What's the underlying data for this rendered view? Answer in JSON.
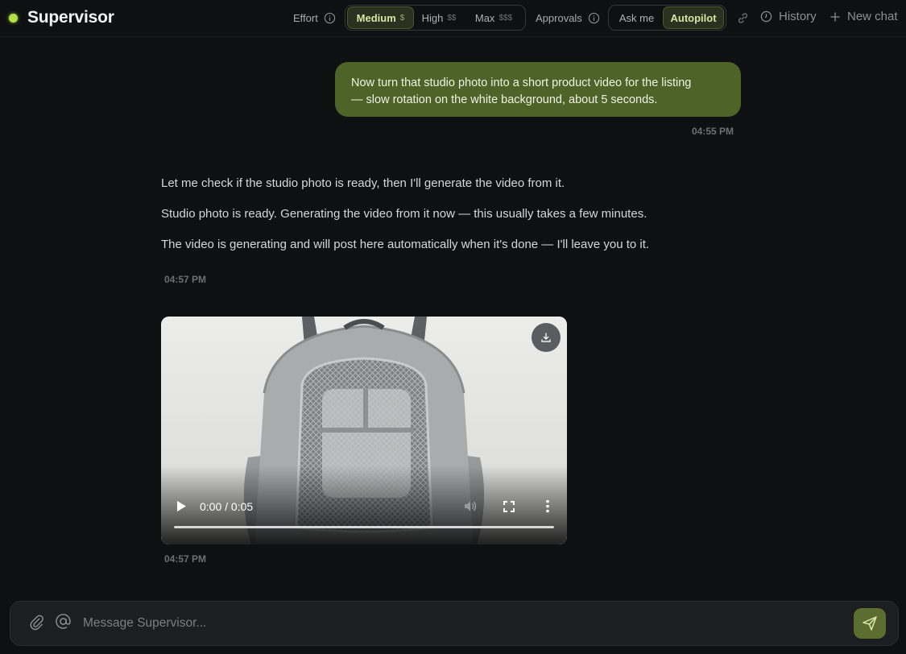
{
  "app": {
    "title": "Supervisor",
    "status_color": "#b4e04a"
  },
  "header": {
    "effort": {
      "label": "Effort",
      "options": [
        {
          "label": "Medium",
          "cost": "$",
          "selected": true
        },
        {
          "label": "High",
          "cost": "$$",
          "selected": false
        },
        {
          "label": "Max",
          "cost": "$$$",
          "selected": false
        }
      ]
    },
    "approvals": {
      "label": "Approvals",
      "options": [
        {
          "label": "Ask me",
          "selected": false
        },
        {
          "label": "Autopilot",
          "selected": true
        }
      ]
    },
    "history_label": "History",
    "new_chat_label": "New chat"
  },
  "messages": [
    {
      "role": "user",
      "lines": [
        "Now turn that studio photo into a short product video for the listing",
        "— slow rotation on the white background, about 5 seconds."
      ],
      "time": "04:55 PM"
    },
    {
      "role": "assistant",
      "paragraphs": [
        "Let me check if the studio photo is ready, then I'll generate the video from it.",
        "Studio photo is ready. Generating the video from it now — this usually takes a few minutes.",
        "The video is generating and will post here automatically when it's done — I'll leave you to it."
      ],
      "time": "04:57 PM"
    },
    {
      "role": "assistant-video",
      "video": {
        "time_display": "0:00 / 0:05",
        "progress": 0
      },
      "time": "04:57 PM"
    }
  ],
  "composer": {
    "placeholder": "Message Supervisor..."
  },
  "colors": {
    "accent": "#4e6328",
    "send": "#5b6e2f",
    "background": "#0f1012"
  }
}
